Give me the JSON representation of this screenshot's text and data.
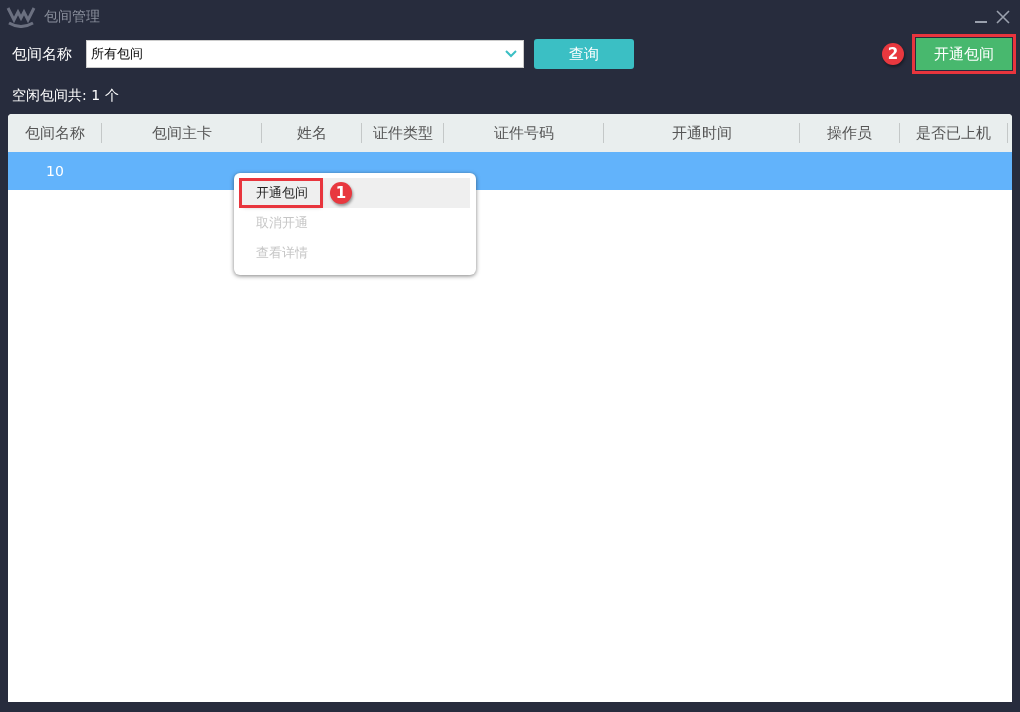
{
  "window": {
    "title": "包间管理"
  },
  "filter": {
    "label": "包间名称",
    "value": "所有包间",
    "query_button": "查询"
  },
  "open_button": {
    "label": "开通包间",
    "annotation": "2"
  },
  "summary": "空闲包间共: 1 个",
  "table": {
    "columns": [
      "包间名称",
      "包间主卡",
      "姓名",
      "证件类型",
      "证件号码",
      "开通时间",
      "操作员",
      "是否已上机"
    ],
    "rows": [
      {
        "cells": [
          "10"
        ],
        "selected": true
      }
    ]
  },
  "context_menu": {
    "items": [
      {
        "label": "开通包间",
        "disabled": false,
        "hovered": true,
        "annotation": "1"
      },
      {
        "label": "取消开通",
        "disabled": true,
        "hovered": false
      },
      {
        "label": "查看详情",
        "disabled": true,
        "hovered": false
      }
    ]
  }
}
